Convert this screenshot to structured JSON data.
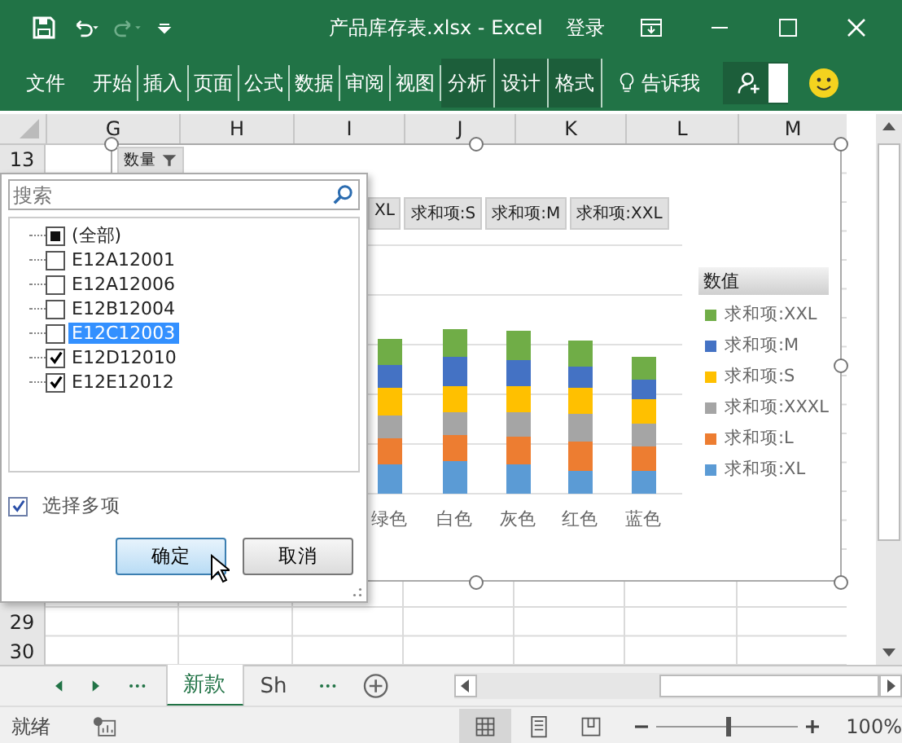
{
  "window": {
    "title": "产品库存表.xlsx - Excel",
    "login": "登录"
  },
  "ribbon_tabs": [
    {
      "label": "文件",
      "contextual": false
    },
    {
      "label": "开始",
      "contextual": false
    },
    {
      "label": "插入",
      "contextual": false
    },
    {
      "label": "页面",
      "contextual": false
    },
    {
      "label": "公式",
      "contextual": false
    },
    {
      "label": "数据",
      "contextual": false
    },
    {
      "label": "审阅",
      "contextual": false
    },
    {
      "label": "视图",
      "contextual": false
    },
    {
      "label": "分析",
      "contextual": true
    },
    {
      "label": "设计",
      "contextual": true
    },
    {
      "label": "格式",
      "contextual": true
    }
  ],
  "tell_me": "告诉我",
  "columns": [
    "G",
    "H",
    "I",
    "J",
    "K",
    "L",
    "M"
  ],
  "rows": [
    "13",
    "29",
    "30"
  ],
  "chart": {
    "filter_button": "数量",
    "field_buttons": [
      "XL",
      "求和项:S",
      "求和项:M",
      "求和项:XXL"
    ],
    "legend_title": "数值",
    "legend": [
      {
        "label": "求和项:XXL",
        "color": "#70ad47"
      },
      {
        "label": "求和项:M",
        "color": "#4472c4"
      },
      {
        "label": "求和项:S",
        "color": "#ffc000"
      },
      {
        "label": "求和项:XXXL",
        "color": "#a5a5a5"
      },
      {
        "label": "求和项:L",
        "color": "#ed7d31"
      },
      {
        "label": "求和项:XL",
        "color": "#5b9bd5"
      }
    ],
    "categories": [
      "绿色",
      "白色",
      "灰色",
      "红色",
      "蓝色"
    ]
  },
  "filter_panel": {
    "search": {
      "placeholder": "搜索"
    },
    "items": [
      {
        "label": "(全部)",
        "partial": true,
        "selected": false
      },
      {
        "label": "E12A12001",
        "checked": false,
        "partial": false,
        "selected": false
      },
      {
        "label": "E12A12006",
        "checked": false,
        "partial": false,
        "selected": false
      },
      {
        "label": "E12B12004",
        "checked": false,
        "partial": false,
        "selected": false
      },
      {
        "label": "E12C12003",
        "checked": false,
        "partial": false,
        "selected": true
      },
      {
        "label": "E12D12010",
        "checked": true,
        "partial": false,
        "selected": false
      },
      {
        "label": "E12E12012",
        "checked": true,
        "partial": false,
        "selected": false
      }
    ],
    "multi_select": {
      "label": "选择多项",
      "checked": true
    },
    "buttons": [
      "确定",
      "取消"
    ]
  },
  "sheet_tabs": [
    {
      "label": "新款",
      "selected": true
    },
    {
      "label": "Sh",
      "selected": false
    }
  ],
  "status_bar": {
    "text": "就绪",
    "zoom": {
      "level": 0.5,
      "reading": "100%"
    }
  }
}
